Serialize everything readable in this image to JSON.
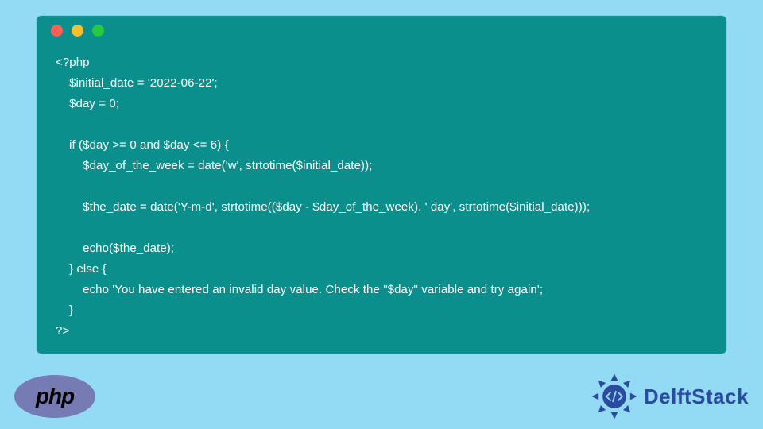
{
  "window": {
    "dots": [
      "red",
      "yellow",
      "green"
    ]
  },
  "code": {
    "lines": [
      "<?php",
      "    $initial_date = '2022-06-22';",
      "    $day = 0;",
      "",
      "    if ($day >= 0 and $day <= 6) {",
      "        $day_of_the_week = date('w', strtotime($initial_date));",
      "",
      "        $the_date = date('Y-m-d', strtotime(($day - $day_of_the_week). ' day', strtotime($initial_date)));",
      "",
      "        echo($the_date);",
      "    } else {",
      "        echo 'You have entered an invalid day value. Check the \"$day\" variable and try again';",
      "    }",
      "?>"
    ]
  },
  "footer": {
    "php_label": "php",
    "delft_label": "DelftStack"
  },
  "colors": {
    "background": "#93daf4",
    "window": "#0b8f8c",
    "php_ellipse": "#777bb3",
    "delft_blue": "#2b4aa0"
  }
}
